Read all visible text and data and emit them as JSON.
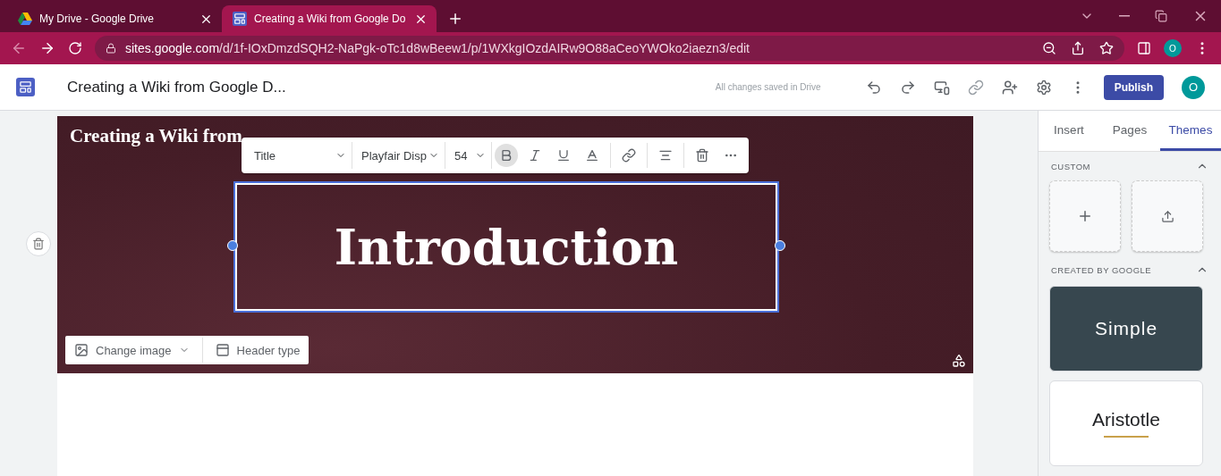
{
  "browser": {
    "tabs": [
      {
        "title": "My Drive - Google Drive",
        "selected": false
      },
      {
        "title": "Creating a Wiki from Google Do",
        "selected": true
      }
    ],
    "url_host": "sites.google.com",
    "url_path": "/d/1f-IOxDmzdSQH2-NaPgk-oTc1d8wBeew1/p/1WXkgIOzdAIRw9O88aCeoYWOko2iaezn3/edit",
    "profile": "O"
  },
  "app_bar": {
    "title": "Creating a Wiki from Google D...",
    "save_status": "All changes saved in Drive",
    "publish": "Publish",
    "avatar": "O"
  },
  "header": {
    "site_title": "Creating a Wiki from",
    "heading": "Introduction",
    "change_image": "Change image",
    "header_type": "Header type"
  },
  "format_toolbar": {
    "style": "Title",
    "font": "Playfair Disp",
    "size": "54",
    "buttons": [
      {
        "kind": "bold",
        "active": true
      },
      {
        "kind": "italic",
        "active": false
      },
      {
        "kind": "underline",
        "active": false
      },
      {
        "kind": "color",
        "active": false
      },
      {
        "kind": "link",
        "active": false
      },
      {
        "kind": "align",
        "active": false
      },
      {
        "kind": "delete",
        "active": false
      },
      {
        "kind": "more",
        "active": false
      }
    ]
  },
  "side_panel": {
    "tabs": [
      {
        "label": "Insert",
        "selected": false
      },
      {
        "label": "Pages",
        "selected": false
      },
      {
        "label": "Themes",
        "selected": true
      }
    ],
    "sections": [
      {
        "title": "CUSTOM",
        "expanded": true
      },
      {
        "title": "CREATED BY GOOGLE",
        "expanded": true
      }
    ],
    "themes": [
      {
        "name": "Simple",
        "kind": "dark"
      },
      {
        "name": "Aristotle",
        "kind": "light"
      }
    ]
  }
}
